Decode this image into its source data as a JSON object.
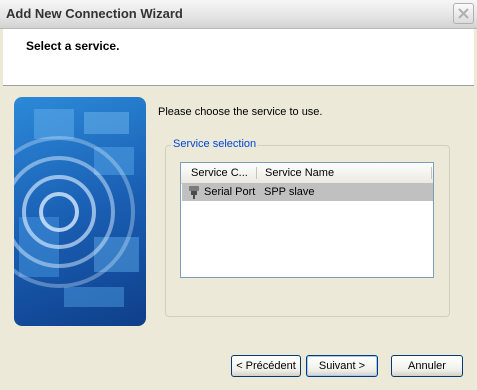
{
  "window": {
    "title": "Add New Connection Wizard"
  },
  "header": {
    "title": "Select a service."
  },
  "content": {
    "instruction": "Please choose the service to use.",
    "group_label": "Service selection",
    "list": {
      "columns": [
        "Service C...",
        "Service Name"
      ],
      "rows": [
        {
          "icon": "serial-port-icon",
          "service_class": "Serial Port",
          "service_name": "SPP slave",
          "selected": true
        }
      ]
    }
  },
  "buttons": {
    "back": "< Précédent",
    "next": "Suivant >",
    "cancel": "Annuler"
  },
  "colors": {
    "group_label": "#0046d5",
    "selection": "#c0c0c0",
    "wizard_image": "#1a5fb4"
  }
}
